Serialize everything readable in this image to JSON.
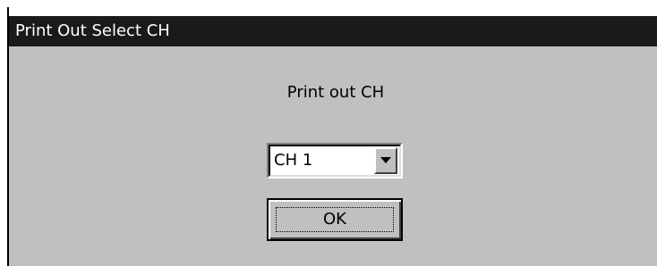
{
  "window": {
    "title": "Print Out Select CH"
  },
  "dialog": {
    "prompt_label": "Print out CH",
    "channel_select": {
      "value": "CH 1"
    },
    "ok_button_label": "OK"
  },
  "icons": {
    "dropdown": "chevron-down-icon"
  },
  "colors": {
    "titlebar_background": "#1a1a1a",
    "titlebar_text": "#ffffff",
    "dialog_background": "#c0c0c0",
    "field_background": "#ffffff"
  }
}
